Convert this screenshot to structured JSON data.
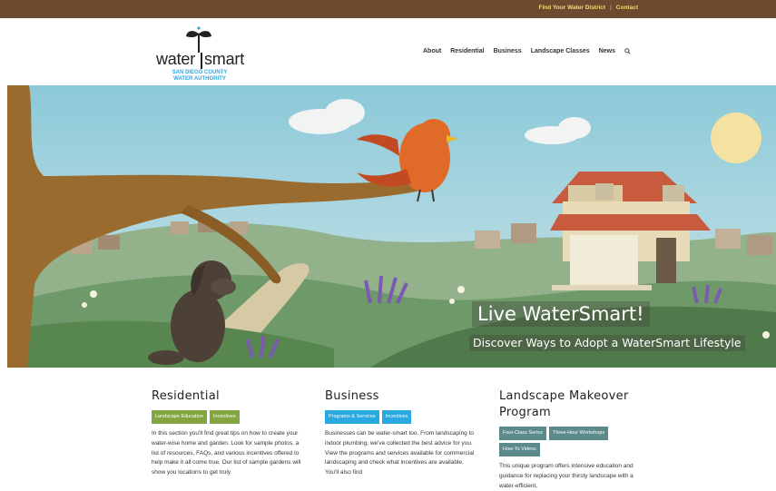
{
  "topbar": {
    "links": [
      "Find Your Water District",
      "Contact"
    ],
    "separator": "|"
  },
  "logo": {
    "word1": "water",
    "word2": "smart",
    "subtitle_line1": "SAN DIEGO COUNTY",
    "subtitle_line2": "WATER AUTHORITY"
  },
  "nav": {
    "items": [
      "About",
      "Residential",
      "Business",
      "Landscape Classes",
      "News"
    ],
    "search_icon": "search-icon"
  },
  "hero": {
    "headline": "Live WaterSmart!",
    "subheadline": "Discover Ways to Adopt a WaterSmart Lifestyle"
  },
  "sections": [
    {
      "title": "Residential",
      "tags": [
        "Landscape Education",
        "Incentives"
      ],
      "text": "In this section you'll find great tips on how to create your water-wise home and garden. Look for sample photos, a list of resources, FAQs, and various incentives offered to help make it all come true. Our list of sample gardens will show you locations to get truly"
    },
    {
      "title": "Business",
      "tags": [
        "Programs & Services",
        "Incentives"
      ],
      "text": "Businesses can be water-smart too. From landscaping to indoor plumbing, we've collected the best advice for you. View the programs and services available for commercial landscaping and check what incentives are available. You'll also find"
    },
    {
      "title_line1": "Landscape Makeover",
      "title_line2": "Program",
      "tags": [
        "Four-Class Series",
        "Three-Hour Workshops",
        "How-To Videos"
      ],
      "text": "This unique program offers intensive education and guidance for replacing your thirsty landscape with a water-efficient,"
    }
  ],
  "colors": {
    "topbar": "#6b4a2f",
    "topbar_link": "#f3dc7a",
    "logo_blue": "#2ea9df",
    "tag_green": "#83a542",
    "tag_blue": "#2aa9e1",
    "tag_slate": "#5a8a8a"
  }
}
